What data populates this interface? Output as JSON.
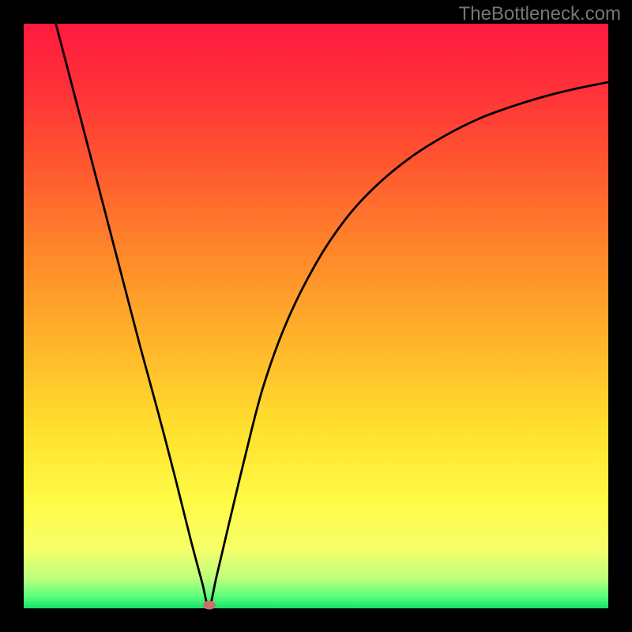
{
  "watermark": "TheBottleneck.com",
  "gradient": {
    "stops": [
      {
        "offset": "0%",
        "color": "#ff1a3f"
      },
      {
        "offset": "12%",
        "color": "#ff3338"
      },
      {
        "offset": "25%",
        "color": "#ff5a2f"
      },
      {
        "offset": "40%",
        "color": "#ff8a2a"
      },
      {
        "offset": "55%",
        "color": "#ffb62a"
      },
      {
        "offset": "70%",
        "color": "#ffe22e"
      },
      {
        "offset": "82%",
        "color": "#fffb47"
      },
      {
        "offset": "90%",
        "color": "#f5ff6a"
      },
      {
        "offset": "95%",
        "color": "#b9ff7d"
      },
      {
        "offset": "98%",
        "color": "#5aff7a"
      },
      {
        "offset": "100%",
        "color": "#17e06a"
      }
    ]
  },
  "curve": {
    "stroke": "#000000",
    "stroke_width": 2.8
  },
  "marker": {
    "x_frac": 0.317,
    "y_frac": 0.995,
    "color": "#cb6f6b"
  },
  "chart_data": {
    "type": "line",
    "title": "",
    "xlabel": "",
    "ylabel": "",
    "xlim": [
      0,
      1
    ],
    "ylim": [
      0,
      1
    ],
    "grid": false,
    "legend": false,
    "series": [
      {
        "name": "curve",
        "x": [
          0.055,
          0.08,
          0.11,
          0.14,
          0.17,
          0.2,
          0.23,
          0.26,
          0.285,
          0.305,
          0.317,
          0.33,
          0.35,
          0.38,
          0.41,
          0.45,
          0.5,
          0.55,
          0.6,
          0.66,
          0.72,
          0.78,
          0.84,
          0.9,
          0.95,
          1.0
        ],
        "y": [
          1.0,
          0.905,
          0.79,
          0.675,
          0.56,
          0.445,
          0.335,
          0.22,
          0.12,
          0.045,
          0.003,
          0.055,
          0.14,
          0.265,
          0.38,
          0.49,
          0.59,
          0.665,
          0.72,
          0.77,
          0.808,
          0.838,
          0.86,
          0.878,
          0.89,
          0.9
        ]
      }
    ],
    "annotations": [
      {
        "type": "marker",
        "x": 0.317,
        "y": 0.003,
        "color": "#cb6f6b"
      }
    ],
    "background": "vertical-gradient red→orange→yellow→green"
  }
}
